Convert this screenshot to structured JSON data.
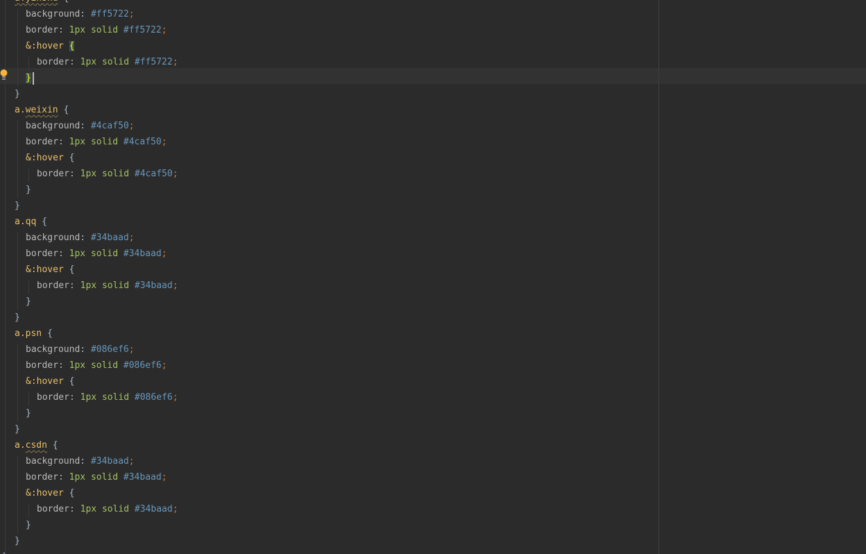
{
  "editor": {
    "lines": [
      {
        "indent": 0,
        "tokens": [
          {
            "c": "sel-wavy",
            "t": "a.yinshu"
          },
          {
            "c": "punc",
            "t": " {"
          }
        ]
      },
      {
        "indent": 1,
        "tokens": [
          {
            "c": "prop",
            "t": "background"
          },
          {
            "c": "punc",
            "t": ": "
          },
          {
            "c": "hex",
            "t": "#ff5722"
          },
          {
            "c": "semi",
            "t": ";"
          }
        ]
      },
      {
        "indent": 1,
        "tokens": [
          {
            "c": "prop",
            "t": "border"
          },
          {
            "c": "punc",
            "t": ": "
          },
          {
            "c": "num",
            "t": "1px"
          },
          {
            "c": "punc",
            "t": " "
          },
          {
            "c": "kw",
            "t": "solid"
          },
          {
            "c": "punc",
            "t": " "
          },
          {
            "c": "hex",
            "t": "#ff5722"
          },
          {
            "c": "semi",
            "t": ";"
          }
        ]
      },
      {
        "indent": 1,
        "tokens": [
          {
            "c": "amp",
            "t": "&:hover"
          },
          {
            "c": "punc",
            "t": " "
          },
          {
            "c": "brace-match",
            "t": "{"
          }
        ]
      },
      {
        "indent": 2,
        "tokens": [
          {
            "c": "prop",
            "t": "border"
          },
          {
            "c": "punc",
            "t": ": "
          },
          {
            "c": "num",
            "t": "1px"
          },
          {
            "c": "punc",
            "t": " "
          },
          {
            "c": "kw",
            "t": "solid"
          },
          {
            "c": "punc",
            "t": " "
          },
          {
            "c": "hex",
            "t": "#ff5722"
          },
          {
            "c": "semi",
            "t": ";"
          }
        ]
      },
      {
        "indent": 1,
        "current": true,
        "tokens": [
          {
            "c": "brace-match",
            "t": "}"
          }
        ]
      },
      {
        "indent": 0,
        "tokens": [
          {
            "c": "punc",
            "t": "}"
          }
        ]
      },
      {
        "indent": 0,
        "tokens": [
          {
            "c": "sel",
            "t": "a."
          },
          {
            "c": "sel-wavy",
            "t": "weixin"
          },
          {
            "c": "punc",
            "t": " {"
          }
        ]
      },
      {
        "indent": 1,
        "tokens": [
          {
            "c": "prop",
            "t": "background"
          },
          {
            "c": "punc",
            "t": ": "
          },
          {
            "c": "hex",
            "t": "#4caf50"
          },
          {
            "c": "semi",
            "t": ";"
          }
        ]
      },
      {
        "indent": 1,
        "tokens": [
          {
            "c": "prop",
            "t": "border"
          },
          {
            "c": "punc",
            "t": ": "
          },
          {
            "c": "num",
            "t": "1px"
          },
          {
            "c": "punc",
            "t": " "
          },
          {
            "c": "kw",
            "t": "solid"
          },
          {
            "c": "punc",
            "t": " "
          },
          {
            "c": "hex",
            "t": "#4caf50"
          },
          {
            "c": "semi",
            "t": ";"
          }
        ]
      },
      {
        "indent": 1,
        "tokens": [
          {
            "c": "amp",
            "t": "&:hover"
          },
          {
            "c": "punc",
            "t": " {"
          }
        ]
      },
      {
        "indent": 2,
        "tokens": [
          {
            "c": "prop",
            "t": "border"
          },
          {
            "c": "punc",
            "t": ": "
          },
          {
            "c": "num",
            "t": "1px"
          },
          {
            "c": "punc",
            "t": " "
          },
          {
            "c": "kw",
            "t": "solid"
          },
          {
            "c": "punc",
            "t": " "
          },
          {
            "c": "hex",
            "t": "#4caf50"
          },
          {
            "c": "semi",
            "t": ";"
          }
        ]
      },
      {
        "indent": 1,
        "tokens": [
          {
            "c": "punc",
            "t": "}"
          }
        ]
      },
      {
        "indent": 0,
        "tokens": [
          {
            "c": "punc",
            "t": "}"
          }
        ]
      },
      {
        "indent": 0,
        "tokens": [
          {
            "c": "sel",
            "t": "a.qq"
          },
          {
            "c": "punc",
            "t": " {"
          }
        ]
      },
      {
        "indent": 1,
        "tokens": [
          {
            "c": "prop",
            "t": "background"
          },
          {
            "c": "punc",
            "t": ": "
          },
          {
            "c": "hex",
            "t": "#34baad"
          },
          {
            "c": "semi",
            "t": ";"
          }
        ]
      },
      {
        "indent": 1,
        "tokens": [
          {
            "c": "prop",
            "t": "border"
          },
          {
            "c": "punc",
            "t": ": "
          },
          {
            "c": "num",
            "t": "1px"
          },
          {
            "c": "punc",
            "t": " "
          },
          {
            "c": "kw",
            "t": "solid"
          },
          {
            "c": "punc",
            "t": " "
          },
          {
            "c": "hex",
            "t": "#34baad"
          },
          {
            "c": "semi",
            "t": ";"
          }
        ]
      },
      {
        "indent": 1,
        "tokens": [
          {
            "c": "amp",
            "t": "&:hover"
          },
          {
            "c": "punc",
            "t": " {"
          }
        ]
      },
      {
        "indent": 2,
        "tokens": [
          {
            "c": "prop",
            "t": "border"
          },
          {
            "c": "punc",
            "t": ": "
          },
          {
            "c": "num",
            "t": "1px"
          },
          {
            "c": "punc",
            "t": " "
          },
          {
            "c": "kw",
            "t": "solid"
          },
          {
            "c": "punc",
            "t": " "
          },
          {
            "c": "hex",
            "t": "#34baad"
          },
          {
            "c": "semi",
            "t": ";"
          }
        ]
      },
      {
        "indent": 1,
        "tokens": [
          {
            "c": "punc",
            "t": "}"
          }
        ]
      },
      {
        "indent": 0,
        "tokens": [
          {
            "c": "punc",
            "t": "}"
          }
        ]
      },
      {
        "indent": 0,
        "tokens": [
          {
            "c": "sel",
            "t": "a.psn"
          },
          {
            "c": "punc",
            "t": " {"
          }
        ]
      },
      {
        "indent": 1,
        "tokens": [
          {
            "c": "prop",
            "t": "background"
          },
          {
            "c": "punc",
            "t": ": "
          },
          {
            "c": "hex",
            "t": "#086ef6"
          },
          {
            "c": "semi",
            "t": ";"
          }
        ]
      },
      {
        "indent": 1,
        "tokens": [
          {
            "c": "prop",
            "t": "border"
          },
          {
            "c": "punc",
            "t": ": "
          },
          {
            "c": "num",
            "t": "1px"
          },
          {
            "c": "punc",
            "t": " "
          },
          {
            "c": "kw",
            "t": "solid"
          },
          {
            "c": "punc",
            "t": " "
          },
          {
            "c": "hex",
            "t": "#086ef6"
          },
          {
            "c": "semi",
            "t": ";"
          }
        ]
      },
      {
        "indent": 1,
        "tokens": [
          {
            "c": "amp",
            "t": "&:hover"
          },
          {
            "c": "punc",
            "t": " {"
          }
        ]
      },
      {
        "indent": 2,
        "tokens": [
          {
            "c": "prop",
            "t": "border"
          },
          {
            "c": "punc",
            "t": ": "
          },
          {
            "c": "num",
            "t": "1px"
          },
          {
            "c": "punc",
            "t": " "
          },
          {
            "c": "kw",
            "t": "solid"
          },
          {
            "c": "punc",
            "t": " "
          },
          {
            "c": "hex",
            "t": "#086ef6"
          },
          {
            "c": "semi",
            "t": ";"
          }
        ]
      },
      {
        "indent": 1,
        "tokens": [
          {
            "c": "punc",
            "t": "}"
          }
        ]
      },
      {
        "indent": 0,
        "tokens": [
          {
            "c": "punc",
            "t": "}"
          }
        ]
      },
      {
        "indent": 0,
        "tokens": [
          {
            "c": "sel",
            "t": "a."
          },
          {
            "c": "sel-wavy",
            "t": "csdn"
          },
          {
            "c": "punc",
            "t": " {"
          }
        ]
      },
      {
        "indent": 1,
        "tokens": [
          {
            "c": "prop",
            "t": "background"
          },
          {
            "c": "punc",
            "t": ": "
          },
          {
            "c": "hex",
            "t": "#34baad"
          },
          {
            "c": "semi",
            "t": ";"
          }
        ]
      },
      {
        "indent": 1,
        "tokens": [
          {
            "c": "prop",
            "t": "border"
          },
          {
            "c": "punc",
            "t": ": "
          },
          {
            "c": "num",
            "t": "1px"
          },
          {
            "c": "punc",
            "t": " "
          },
          {
            "c": "kw",
            "t": "solid"
          },
          {
            "c": "punc",
            "t": " "
          },
          {
            "c": "hex",
            "t": "#34baad"
          },
          {
            "c": "semi",
            "t": ";"
          }
        ]
      },
      {
        "indent": 1,
        "tokens": [
          {
            "c": "amp",
            "t": "&:hover"
          },
          {
            "c": "punc",
            "t": " {"
          }
        ]
      },
      {
        "indent": 2,
        "tokens": [
          {
            "c": "prop",
            "t": "border"
          },
          {
            "c": "punc",
            "t": ": "
          },
          {
            "c": "num",
            "t": "1px"
          },
          {
            "c": "punc",
            "t": " "
          },
          {
            "c": "kw",
            "t": "solid"
          },
          {
            "c": "punc",
            "t": " "
          },
          {
            "c": "hex",
            "t": "#34baad"
          },
          {
            "c": "semi",
            "t": ";"
          }
        ]
      },
      {
        "indent": 1,
        "tokens": [
          {
            "c": "punc",
            "t": "}"
          }
        ]
      },
      {
        "indent": 0,
        "tokens": [
          {
            "c": "punc",
            "t": "}"
          }
        ]
      },
      {
        "indent": -1,
        "tokens": [
          {
            "c": "punc",
            "t": "}"
          }
        ]
      }
    ]
  },
  "icons": {
    "intention_bulb": "lightbulb-icon"
  },
  "colors": {
    "background": "#2b2b2b",
    "current_line": "#323232",
    "selector": "#e8bf6a",
    "property": "#bababa",
    "number": "#a5c261",
    "hex": "#6897bb",
    "semicolon": "#cc7832",
    "brace_match": "#ffef28"
  }
}
